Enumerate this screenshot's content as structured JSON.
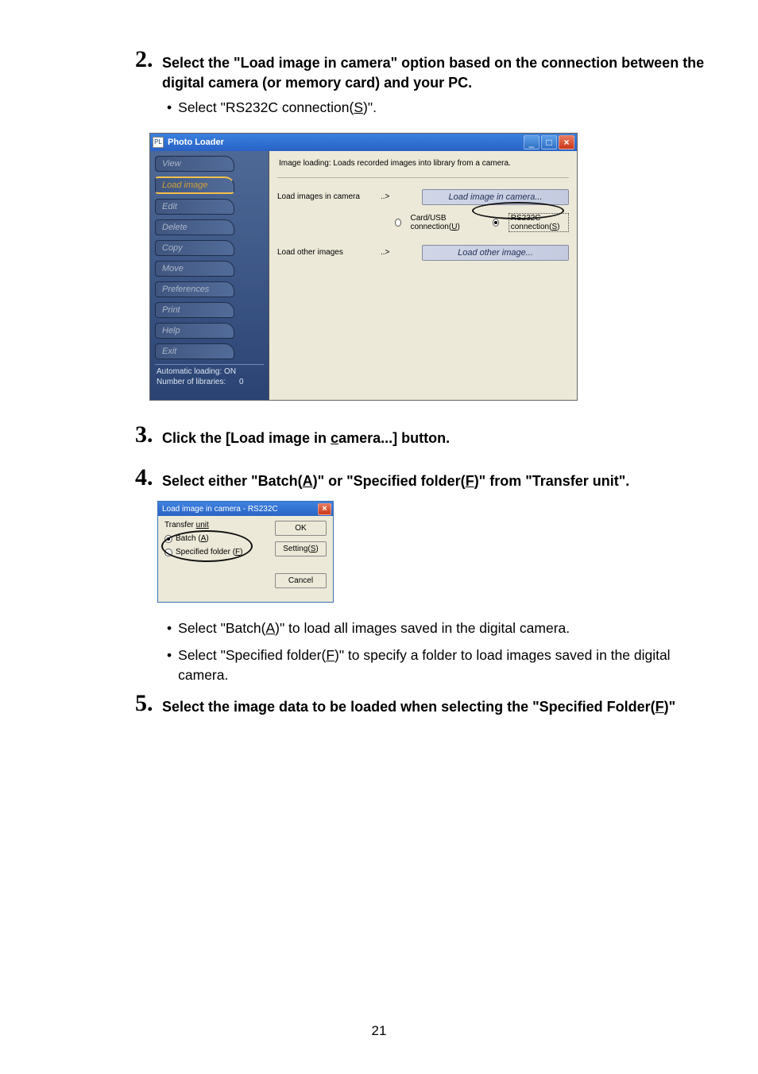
{
  "steps": {
    "s2": {
      "num": "2.",
      "text": "Select the \"Load image in camera\" option based on the connection between the digital camera (or memory card) and your PC."
    },
    "s2_bullet": {
      "pre": "Select \"RS232C connection(",
      "u": "S",
      "post": ")\"."
    },
    "s3": {
      "num": "3.",
      "pre": "Click the [Load image in ",
      "u": "c",
      "post": "amera...] button."
    },
    "s4": {
      "num": "4.",
      "pre": "Select either \"Batch(",
      "u1": "A",
      "mid": ")\" or \"Specified folder(",
      "u2": "F",
      "post": ")\" from \"Transfer unit\"."
    },
    "s4_b1": {
      "pre": "Select \"Batch(",
      "u": "A",
      "post": ")\" to load all images saved in the digital camera."
    },
    "s4_b2": {
      "pre": "Select \"Specified folder(",
      "u": "F",
      "post": ")\" to specify a folder to load images saved in the digital camera."
    },
    "s5": {
      "num": "5.",
      "pre": "Select the image data to be loaded when selecting the \"Specified Folder(",
      "u": "F",
      "post": ")\""
    }
  },
  "screenshot1": {
    "title": "Photo Loader",
    "sidebar": [
      "View",
      "Load image",
      "Edit",
      "Delete",
      "Copy",
      "Move",
      "Preferences",
      "Print",
      "Help",
      "Exit"
    ],
    "status1": "Automatic loading:  ON",
    "status2": "Number of libraries:",
    "status2_val": "0",
    "desc": "Image loading: Loads recorded images into library from a camera.",
    "row1_label": "Load images in camera",
    "arrow": "..>",
    "btn1": "Load image in camera...",
    "radio_off_pre": "Card/USB connection(",
    "radio_off_u": "U",
    "radio_off_post": ")",
    "radio_on_pre": "RS232C connection(",
    "radio_on_u": "S",
    "radio_on_post": ")",
    "row2_label": "Load other images",
    "btn2": "Load other image..."
  },
  "dialog2": {
    "title": "Load image in camera - RS232C",
    "group_pre": "Transfer ",
    "group_u": "unit",
    "r1_pre": "Batch (",
    "r1_u": "A",
    "r1_post": ")",
    "r2_pre": "Specified folder (",
    "r2_u": "F",
    "r2_post": ")",
    "ok": "OK",
    "setting_pre": "Setting(",
    "setting_u": "S",
    "setting_post": ")",
    "cancel": "Cancel"
  },
  "page_number": "21"
}
